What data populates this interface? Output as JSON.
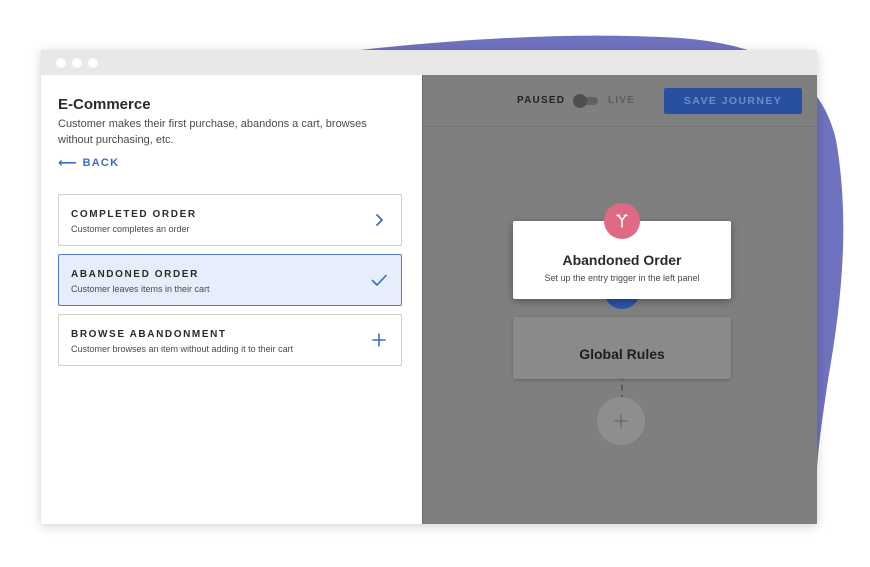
{
  "colors": {
    "accent": "#3a6dc4",
    "blob": "#6f72bf",
    "overlay": "#7f7f7f",
    "save_button": "#2750a0",
    "trigger_badge": "#e06a84",
    "rules_badge": "#2954a6",
    "selected_card_bg": "#e7eefb"
  },
  "panel": {
    "title": "E-Commerce",
    "description": "Customer makes their first purchase, abandons a cart, browses without purchasing, etc.",
    "back_label": "BACK",
    "back_icon": "arrow-left-icon"
  },
  "triggers": [
    {
      "title": "COMPLETED ORDER",
      "subtitle": "Customer completes an order",
      "icon": "chevron-right-icon",
      "selected": false
    },
    {
      "title": "ABANDONED ORDER",
      "subtitle": "Customer leaves items in their cart",
      "icon": "check-icon",
      "selected": true
    },
    {
      "title": "BROWSE ABANDONMENT",
      "subtitle": "Customer browses an item without adding it to their cart",
      "icon": "plus-icon",
      "selected": false
    }
  ],
  "toolbar": {
    "paused_label": "PAUSED",
    "live_label": "LIVE",
    "toggle_state": "paused",
    "save_label": "SAVE JOURNEY"
  },
  "journey": {
    "trigger_node": {
      "title": "Abandoned Order",
      "subtitle": "Set up the entry trigger in the left panel",
      "icon": "split-icon"
    },
    "rules_node": {
      "title": "Global Rules",
      "icon": "check-icon"
    },
    "add_step_icon": "plus-icon"
  }
}
